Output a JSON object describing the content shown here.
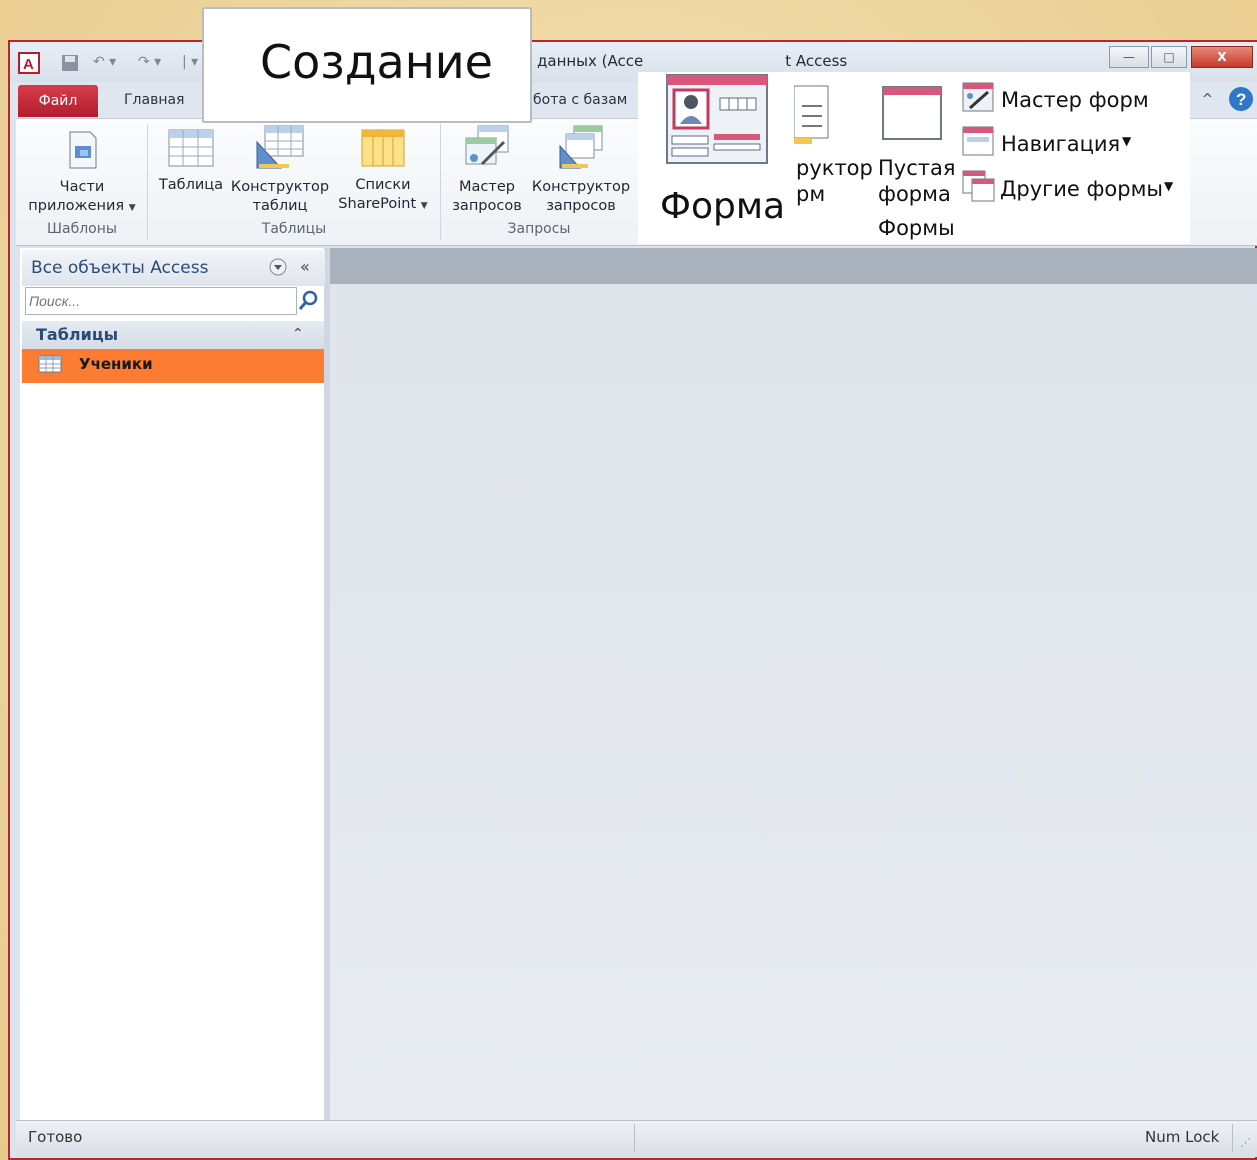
{
  "window": {
    "title_visible": "данных (Acce",
    "title_visible_2": "t Access",
    "minimize_label": "—",
    "restore_label": "□",
    "close_label": "X"
  },
  "tabs": {
    "file": "Файл",
    "home": "Главная",
    "database_tools_partial": "бота с базам"
  },
  "ribbon": {
    "templates": {
      "app_parts": [
        "Части",
        "приложения"
      ],
      "group_label": "Шаблоны"
    },
    "tables": {
      "table": "Таблица",
      "table_design": [
        "Конструктор",
        "таблиц"
      ],
      "sharepoint_lists": [
        "Списки",
        "SharePoint"
      ],
      "group_label": "Таблицы"
    },
    "queries": {
      "query_wizard": [
        "Мастер",
        "запросов"
      ],
      "query_design": [
        "Конструктор",
        "запросов"
      ],
      "group_label": "Запросы"
    }
  },
  "callouts": {
    "create_tab": "Создание",
    "forms": {
      "form": "Форма",
      "form_design_partial": [
        "руктор",
        "рм"
      ],
      "blank_form": [
        "Пустая",
        "форма"
      ],
      "group_label": "Формы",
      "form_wizard": "Мастер форм",
      "navigation": "Навигация",
      "more_forms": "Другие формы"
    }
  },
  "nav_pane": {
    "title": "Все объекты Access",
    "search_placeholder": "Поиск...",
    "section_label": "Таблицы",
    "items": [
      {
        "label": "Ученики"
      }
    ]
  },
  "status": {
    "left": "Готово",
    "right": "Num Lock"
  },
  "colors": {
    "accent": "#b01e2f",
    "selected_item": "#fb7c32",
    "nav_text": "#2a4a78"
  }
}
